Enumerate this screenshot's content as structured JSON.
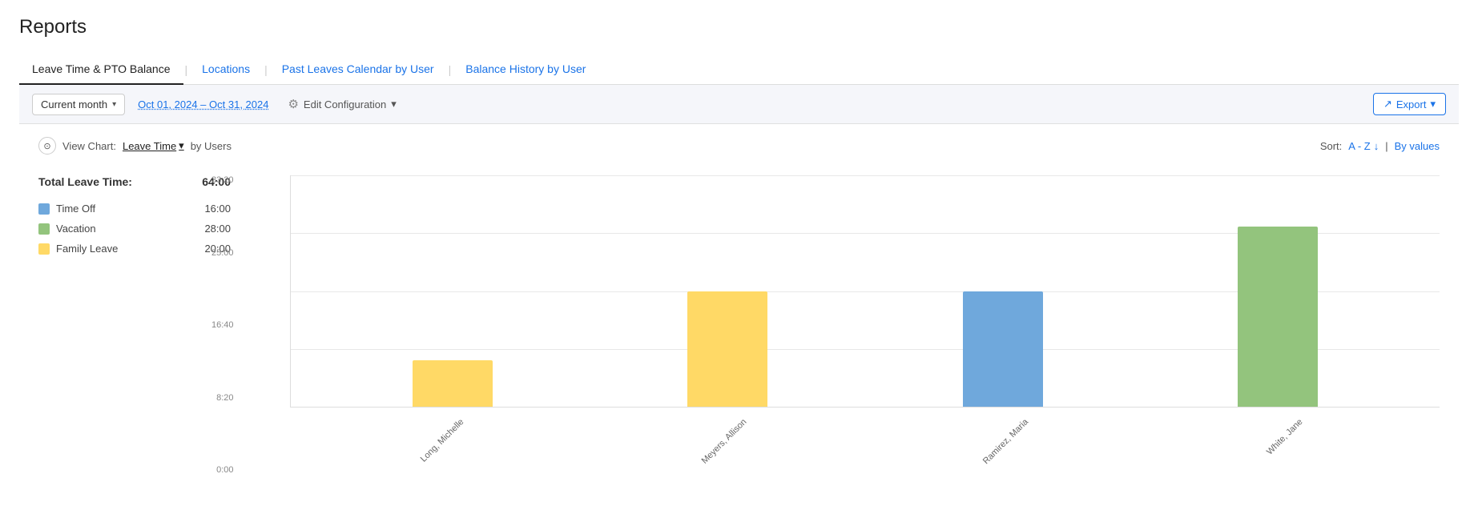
{
  "page": {
    "title": "Reports"
  },
  "tabs": [
    {
      "id": "leave-time",
      "label": "Leave Time & PTO Balance",
      "active": true
    },
    {
      "id": "locations",
      "label": "Locations",
      "active": false
    },
    {
      "id": "past-leaves",
      "label": "Past Leaves Calendar by User",
      "active": false
    },
    {
      "id": "balance-history",
      "label": "Balance History by User",
      "active": false
    }
  ],
  "toolbar": {
    "filter_label": "Current month",
    "date_range": "Oct 01, 2024 – Oct 31, 2024",
    "edit_config_label": "Edit Configuration",
    "export_label": "Export"
  },
  "view_chart": {
    "label": "View Chart:",
    "chart_type": "Leave Time",
    "by_label": "by Users"
  },
  "sort": {
    "label": "Sort:",
    "az_label": "A - Z",
    "by_values_label": "By values"
  },
  "legend": {
    "total_label": "Total Leave Time:",
    "total_value": "64:00",
    "items": [
      {
        "id": "time-off",
        "label": "Time Off",
        "value": "16:00",
        "color": "#6fa8dc"
      },
      {
        "id": "vacation",
        "label": "Vacation",
        "value": "28:00",
        "color": "#93c47d"
      },
      {
        "id": "family-leave",
        "label": "Family Leave",
        "value": "20:00",
        "color": "#ffd966"
      }
    ]
  },
  "chart": {
    "y_labels": [
      "33:20",
      "25:00",
      "16:40",
      "8:20",
      "0:00"
    ],
    "bars": [
      {
        "name": "Long, Michelle",
        "value": 4,
        "color": "#ffd966",
        "height_pct": 20
      },
      {
        "name": "Meyers, Allison",
        "value": 16,
        "color": "#ffd966",
        "height_pct": 50
      },
      {
        "name": "Ramirez, Maria",
        "value": 16,
        "color": "#6fa8dc",
        "height_pct": 50
      },
      {
        "name": "White, Jane",
        "value": 26,
        "color": "#93c47d",
        "height_pct": 78
      }
    ]
  },
  "icons": {
    "collapse": "⊙",
    "dropdown_arrow": "▾",
    "gear": "⚙",
    "export_arrow": "↗",
    "sort_az": "↓"
  }
}
